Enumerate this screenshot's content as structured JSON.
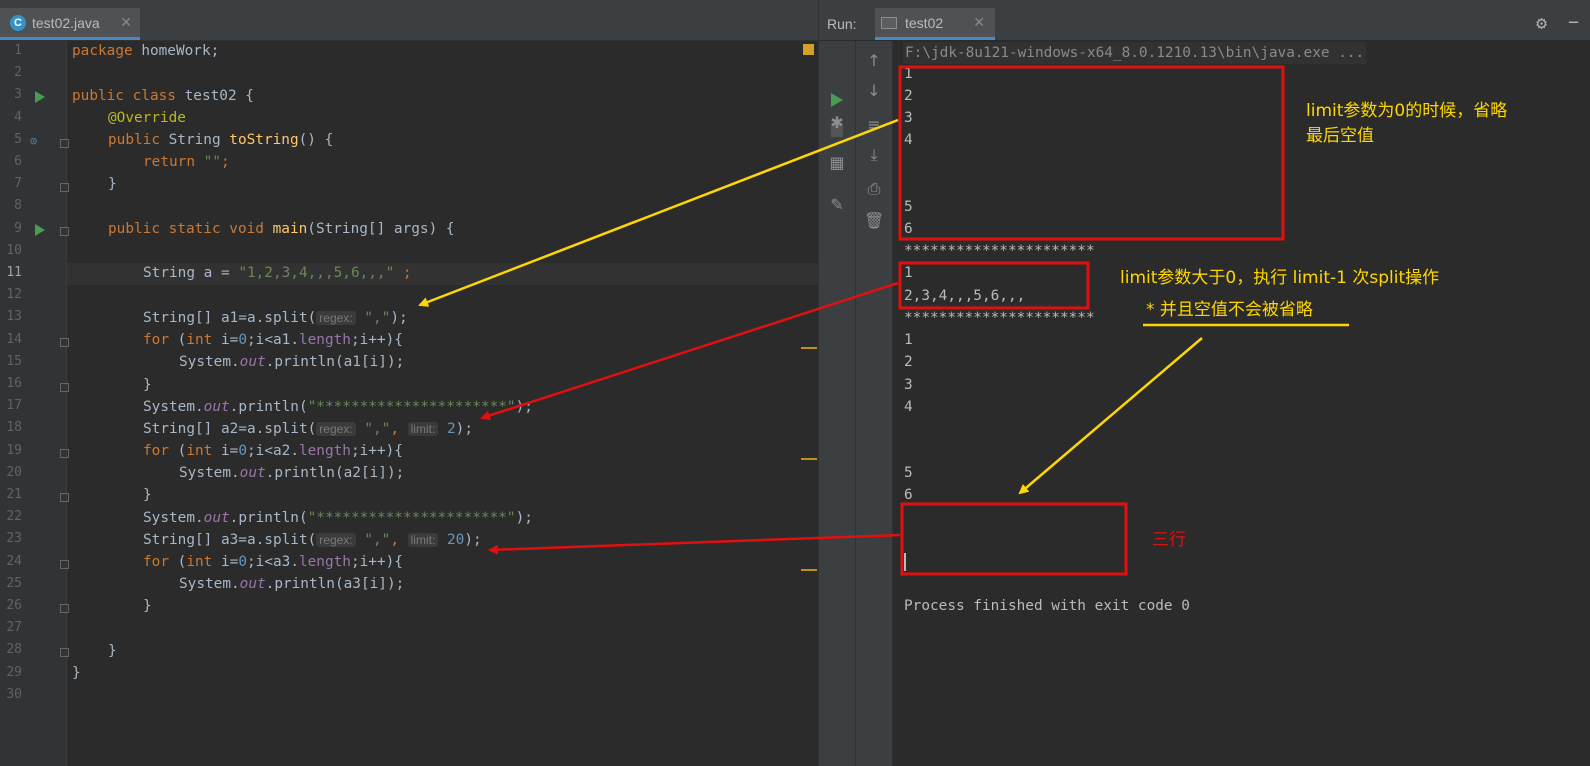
{
  "editor": {
    "tab": {
      "icon_letter": "C",
      "filename": "test02.java",
      "close": "✕"
    },
    "line_numbers": [
      "1",
      "2",
      "3",
      "4",
      "5",
      "6",
      "7",
      "8",
      "9",
      "10",
      "11",
      "12",
      "13",
      "14",
      "15",
      "16",
      "17",
      "18",
      "19",
      "20",
      "21",
      "22",
      "23",
      "24",
      "25",
      "26",
      "27",
      "28",
      "29",
      "30"
    ],
    "code": {
      "l1_kw": "package",
      "l1_rest": " homeWork;",
      "l3_kw": "public class",
      "l3_rest": " test02 {",
      "l4_ann": "@Override",
      "l5_kw": "public",
      "l5_type": " String ",
      "l5_fn": "toString",
      "l5_rest": "() {",
      "l6_kw": "return",
      "l6_str": " \"\"",
      "l6_end": ";",
      "l7": "}",
      "l9_kw": "public static void",
      "l9_fn": " main",
      "l9_rest": "(String[] args) {",
      "l11_pre": "String a = ",
      "l11_str": "\"1,2,3,4,,,5,6,,,\"",
      "l11_end": " ;",
      "l13_pre": "String[] a1=a.split(",
      "l13_hint": "regex:",
      "l13_str": "\",\"",
      "l13_end": ");",
      "l14_kw": "for",
      "l14_a": " (",
      "l14_kw2": "int",
      "l14_b": " i=",
      "l14_num": "0",
      "l14_c": ";i<a1.",
      "l14_fld": "length",
      "l14_d": ";i++){",
      "l15_a": "System.",
      "l15_out": "out",
      "l15_b": ".println(a1[i]);",
      "l16": "}",
      "l17_a": "System.",
      "l17_out": "out",
      "l17_b": ".println(",
      "l17_str": "\"**********************\"",
      "l17_c": ");",
      "l18_pre": "String[] a2=a.split(",
      "l18_hint": "regex:",
      "l18_str": "\",\"",
      "l18_comma": ", ",
      "l18_hint2": "limit:",
      "l18_num": "2",
      "l18_end": ");",
      "l19_kw": "for",
      "l19_a": " (",
      "l19_kw2": "int",
      "l19_b": " i=",
      "l19_num": "0",
      "l19_c": ";i<a2.",
      "l19_fld": "length",
      "l19_d": ";i++){",
      "l20_a": "System.",
      "l20_out": "out",
      "l20_b": ".println(a2[i]);",
      "l21": "}",
      "l22_a": "System.",
      "l22_out": "out",
      "l22_b": ".println(",
      "l22_str": "\"**********************\"",
      "l22_c": ");",
      "l23_pre": "String[] a3=a.split(",
      "l23_hint": "regex:",
      "l23_str": "\",\"",
      "l23_comma": ", ",
      "l23_hint2": "limit:",
      "l23_num": "20",
      "l23_end": ");",
      "l24_kw": "for",
      "l24_a": " (",
      "l24_kw2": "int",
      "l24_b": " i=",
      "l24_num": "0",
      "l24_c": ";i<a3.",
      "l24_fld": "length",
      "l24_d": ";i++){",
      "l25_a": "System.",
      "l25_out": "out",
      "l25_b": ".println(a3[i]);",
      "l26": "}",
      "l28": "}",
      "l29": "}"
    }
  },
  "run": {
    "label": "Run:",
    "tab": "test02",
    "close": "✕",
    "command": "F:\\jdk-8u121-windows-x64_8.0.1210.13\\bin\\java.exe ...",
    "output": {
      "o1": "1",
      "o2": "2",
      "o3": "3",
      "o4": "4",
      "o5": "5",
      "o6": "6",
      "sep1": "**********************",
      "p1": "1",
      "p2": "2,3,4,,,5,6,,,",
      "sep2": "**********************",
      "q1": "1",
      "q2": "2",
      "q3": "3",
      "q4": "4",
      "q5": "5",
      "q6": "6",
      "finished": "Process finished with exit code 0"
    }
  },
  "annotations": {
    "note1_line1": "limit参数为0的时候，省略",
    "note1_line2": "最后空值",
    "note2": "limit参数大于0，执行 limit-1 次split操作",
    "note3": "* 并且空值不会被省略",
    "note4": "三行",
    "colors": {
      "yellow": "#ffd700",
      "red": "#e01010",
      "code_bg": "#2b2b2b"
    }
  }
}
